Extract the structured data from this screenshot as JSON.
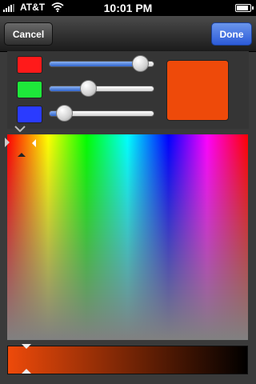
{
  "status_bar": {
    "carrier": "AT&T",
    "time": "10:01 PM",
    "battery_level": 0.85
  },
  "nav": {
    "cancel_label": "Cancel",
    "done_label": "Done"
  },
  "sliders": [
    {
      "channel": "red",
      "swatch_color": "#ff1a1a",
      "value": 0.93
    },
    {
      "channel": "green",
      "swatch_color": "#1ee83a",
      "value": 0.34
    },
    {
      "channel": "blue",
      "swatch_color": "#2a3bff",
      "value": 0.07
    }
  ],
  "colors": {
    "selected": "#ee4a0a",
    "accent": "#2c5bd8"
  },
  "picker": {
    "hue_position": 0.04,
    "saturation": 1.0,
    "brightness": 0.93
  }
}
